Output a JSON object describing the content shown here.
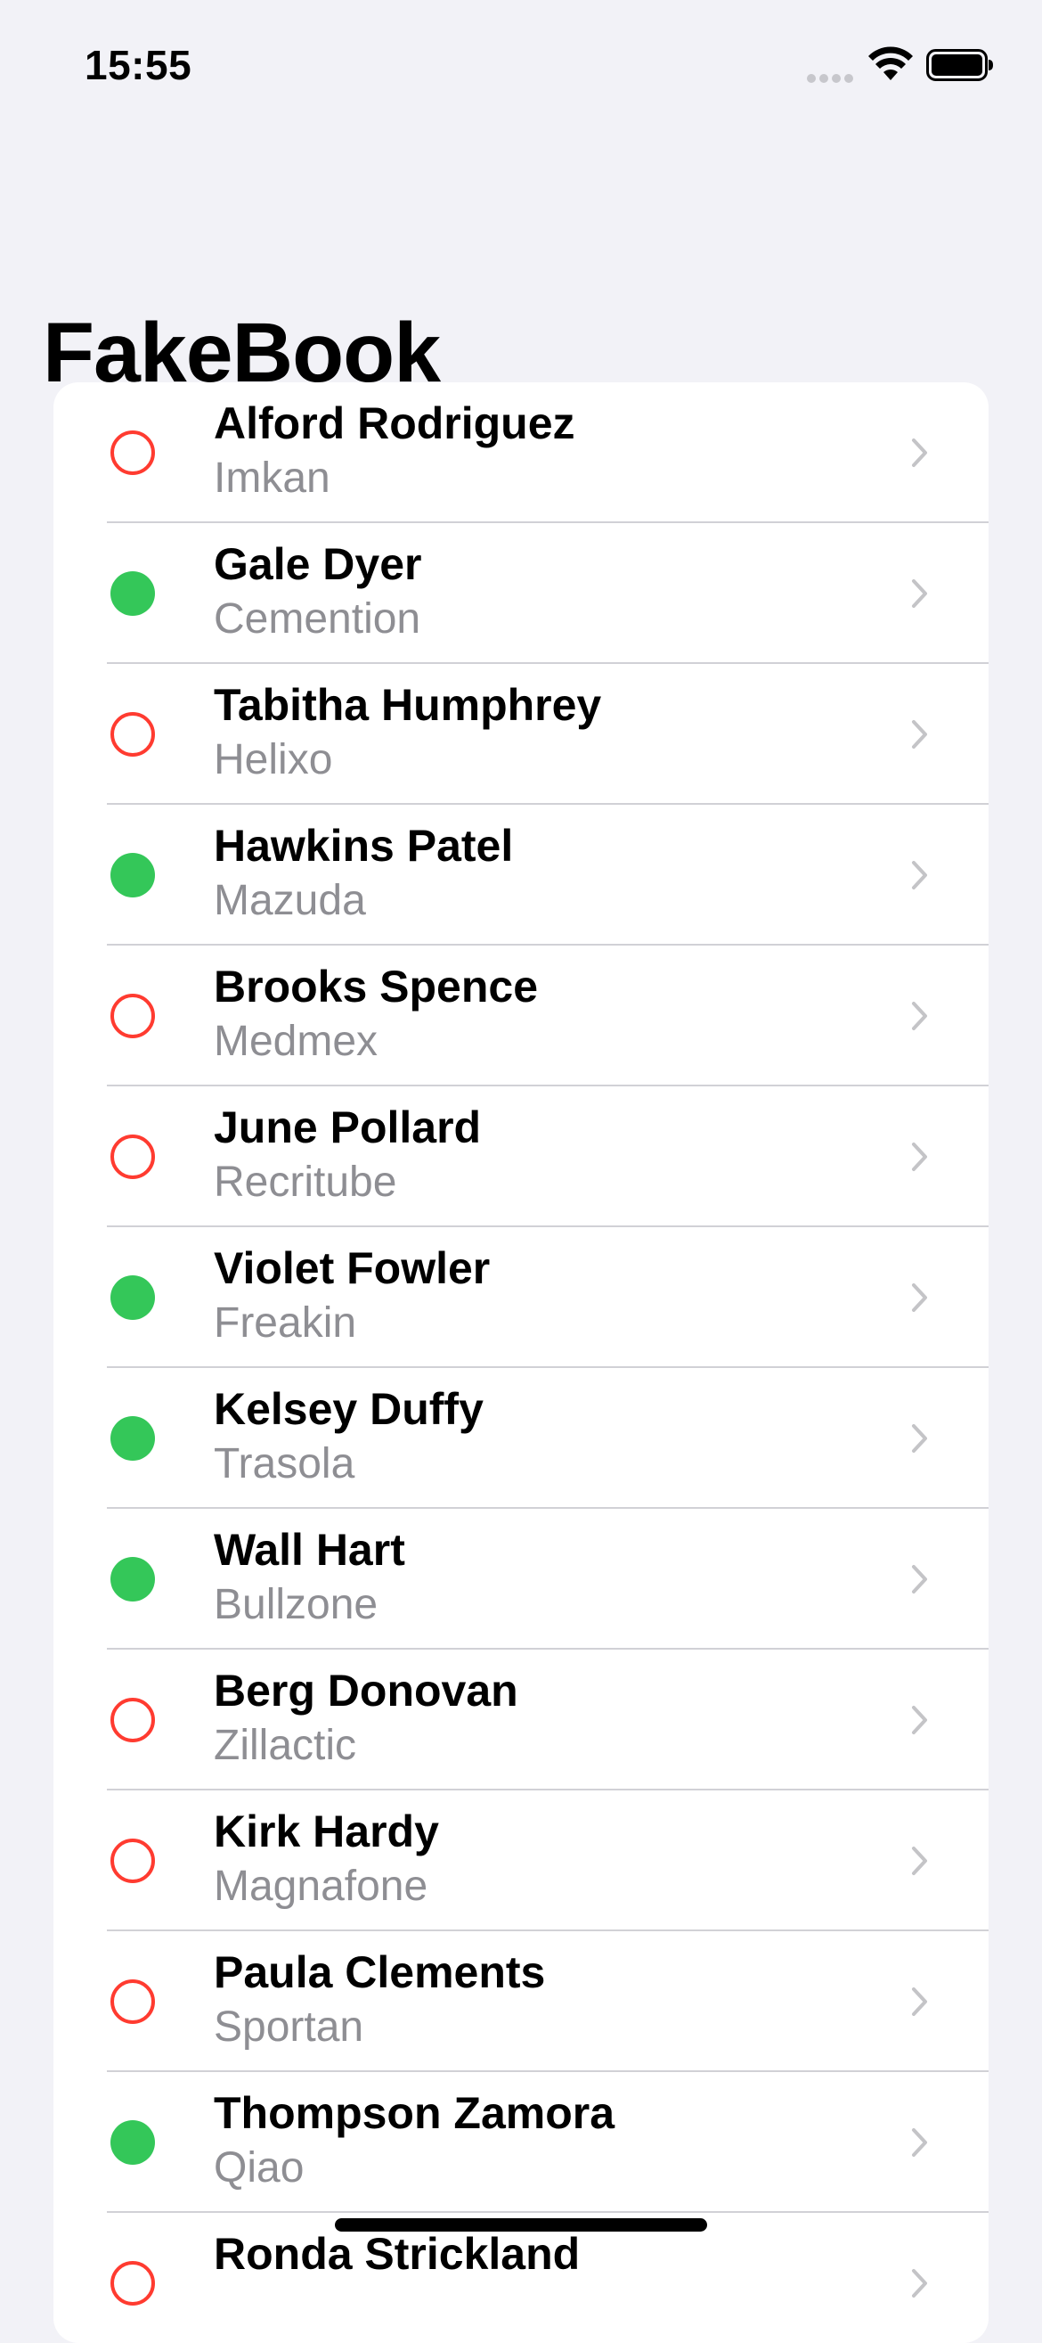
{
  "status_bar": {
    "time": "15:55"
  },
  "page": {
    "title": "FakeBook"
  },
  "colors": {
    "active": "#34c759",
    "inactive": "#ff3b30",
    "secondary_text": "#8e8e93",
    "background": "#f2f2f7"
  },
  "contacts": [
    {
      "name": "Alford Rodriguez",
      "company": "Imkan",
      "active": false
    },
    {
      "name": "Gale Dyer",
      "company": "Cemention",
      "active": true
    },
    {
      "name": "Tabitha Humphrey",
      "company": "Helixo",
      "active": false
    },
    {
      "name": "Hawkins Patel",
      "company": "Mazuda",
      "active": true
    },
    {
      "name": "Brooks Spence",
      "company": "Medmex",
      "active": false
    },
    {
      "name": "June Pollard",
      "company": "Recritube",
      "active": false
    },
    {
      "name": "Violet Fowler",
      "company": "Freakin",
      "active": true
    },
    {
      "name": "Kelsey Duffy",
      "company": "Trasola",
      "active": true
    },
    {
      "name": "Wall Hart",
      "company": "Bullzone",
      "active": true
    },
    {
      "name": "Berg Donovan",
      "company": "Zillactic",
      "active": false
    },
    {
      "name": "Kirk Hardy",
      "company": "Magnafone",
      "active": false
    },
    {
      "name": "Paula Clements",
      "company": "Sportan",
      "active": false
    },
    {
      "name": "Thompson Zamora",
      "company": "Qiao",
      "active": true
    },
    {
      "name": "Ronda Strickland",
      "company": "",
      "active": false
    }
  ]
}
